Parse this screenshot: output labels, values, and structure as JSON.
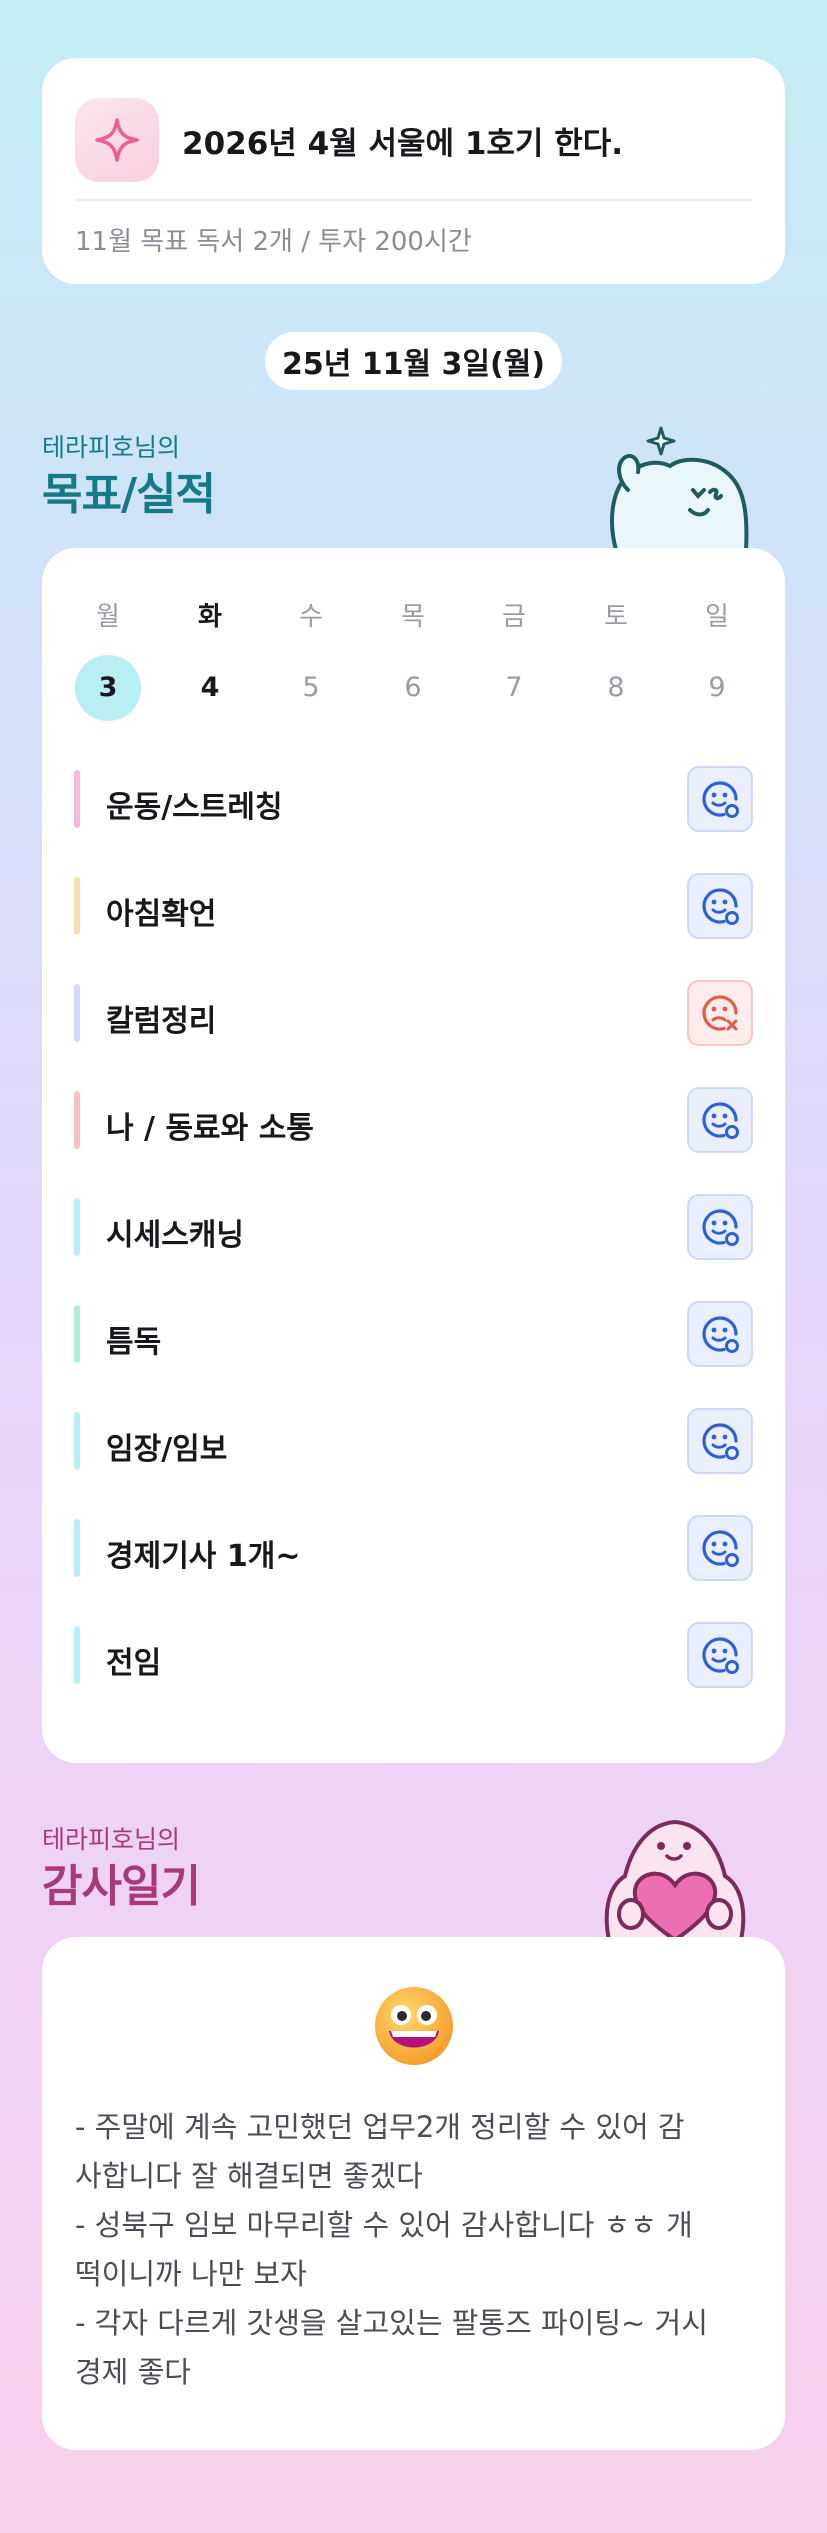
{
  "goal": {
    "title": "2026년 4월 서울에 1호기 한다.",
    "monthly_target": "11월 목표  독서 2개 / 투자 200시간",
    "icon": "sparkle-icon"
  },
  "date_label": "25년 11월 3일(월)",
  "check_section": {
    "small": "테라피호님의",
    "big": "목표/실적",
    "color": "#157a87"
  },
  "week": {
    "days": [
      {
        "weekday": "월",
        "date": "3"
      },
      {
        "weekday": "화",
        "date": "4"
      },
      {
        "weekday": "수",
        "date": "5"
      },
      {
        "weekday": "목",
        "date": "6"
      },
      {
        "weekday": "금",
        "date": "7"
      },
      {
        "weekday": "토",
        "date": "8"
      },
      {
        "weekday": "일",
        "date": "9"
      }
    ],
    "selected_index": 0,
    "today_index": 1
  },
  "habits": [
    {
      "label": "운동/스트레칭",
      "color": "#f7b8dc",
      "status": "done"
    },
    {
      "label": "아침확언",
      "color": "#fbdcae",
      "status": "done"
    },
    {
      "label": "칼럼정리",
      "color": "#d4d9f8",
      "status": "fail"
    },
    {
      "label": "나 / 동료와 소통",
      "color": "#f9c3c3",
      "status": "done"
    },
    {
      "label": "시세스캐닝",
      "color": "#b9eef3",
      "status": "done"
    },
    {
      "label": "틈독",
      "color": "#aef0d5",
      "status": "done"
    },
    {
      "label": "임장/임보",
      "color": "#b9eef3",
      "status": "done"
    },
    {
      "label": "경제기사 1개~",
      "color": "#b9eef3",
      "status": "done"
    },
    {
      "label": "전임",
      "color": "#b9eef3",
      "status": "done"
    }
  ],
  "diary_section": {
    "small": "테라피호님의",
    "big": "감사일기",
    "color": "#a93a78"
  },
  "diary": {
    "emoji": "grinning-face-icon",
    "lines": [
      "- 주말에 계속 고민했던 업무2개 정리할 수 있어 감",
      "사합니다 잘 해결되면 좋겠다",
      "- 성북구 임보 마무리할 수 있어 감사합니다 ㅎㅎ 개",
      "떡이니까 나만 보자",
      "- 각자 다르게 갓생을 살고있는 팔통즈 파이팅~ 거시",
      "경제 좋다"
    ]
  },
  "colors": {
    "done_icon": "#2f5fd6",
    "fail_icon": "#e25a4a"
  }
}
